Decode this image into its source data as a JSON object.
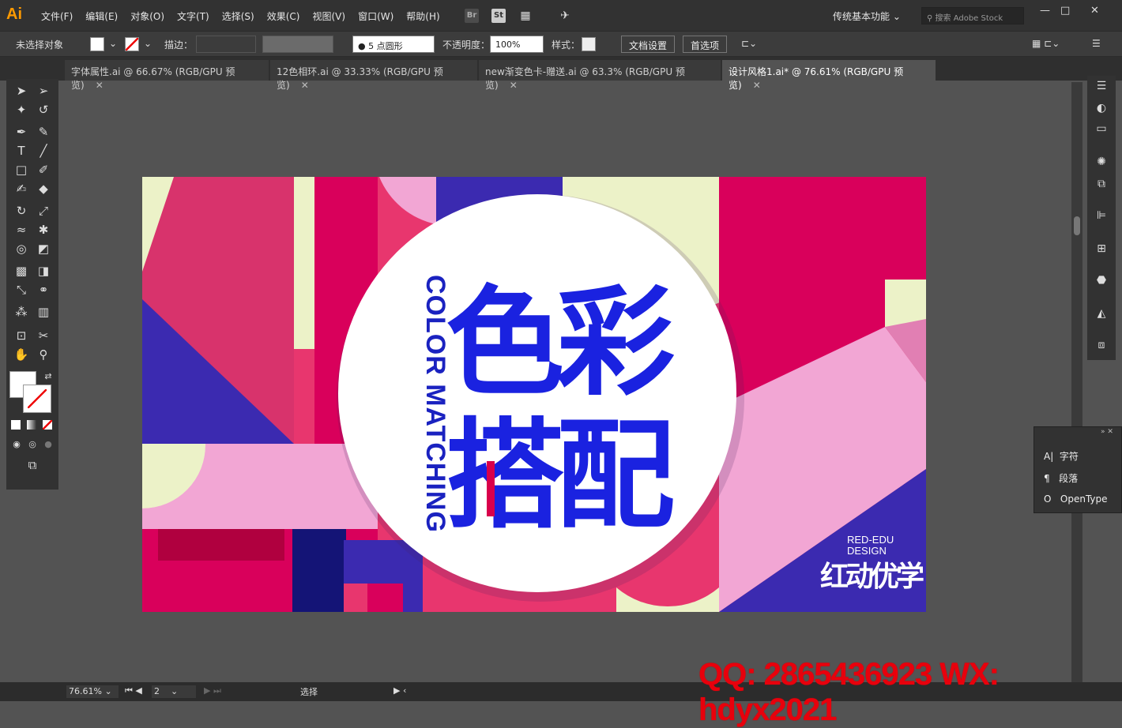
{
  "app": {
    "logo": "Ai"
  },
  "menu": [
    "文件(F)",
    "编辑(E)",
    "对象(O)",
    "文字(T)",
    "选择(S)",
    "效果(C)",
    "视图(V)",
    "窗口(W)",
    "帮助(H)"
  ],
  "top_icons": {
    "br": "Br",
    "st": "St"
  },
  "workspace": "传统基本功能",
  "search": {
    "placeholder": "搜索 Adobe Stock"
  },
  "control_bar": {
    "selection": "未选择对象",
    "stroke_label": "描边：",
    "brush": "5 点圆形",
    "opacity_label": "不透明度：",
    "opacity_value": "100%",
    "style_label": "样式：",
    "doc_setup": "文档设置",
    "prefs": "首选项"
  },
  "tabs": [
    {
      "label": "字体属性.ai @ 66.67% (RGB/GPU 预览)"
    },
    {
      "label": "12色相环.ai @ 33.33% (RGB/GPU 预览)"
    },
    {
      "label": "new渐变色卡-赠送.ai @ 63.3% (RGB/GPU 预览)"
    },
    {
      "label": "设计风格1.ai* @ 76.61% (RGB/GPU 预览)",
      "active": true
    }
  ],
  "char_panel": {
    "items": [
      "字符",
      "段落",
      "OpenType"
    ]
  },
  "artwork": {
    "title_cn_1": "色彩",
    "title_cn_2": "搭配",
    "subtitle_en": "COLOR MATCHING",
    "brand_en_1": "RED-EDU",
    "brand_en_2": "DESIGN",
    "brand_cn": "红动优学"
  },
  "status": {
    "zoom": "76.61%",
    "page": "2",
    "tool": "选择"
  },
  "watermark": "QQ: 2865436923   WX: hdyx2021",
  "colors": {
    "pink": "#e8366e",
    "magenta": "#d9005b",
    "blue": "#3b2ab0",
    "cream": "#ecf2c8",
    "light_pink": "#f2a6d4",
    "text_blue": "#1a22e0"
  }
}
